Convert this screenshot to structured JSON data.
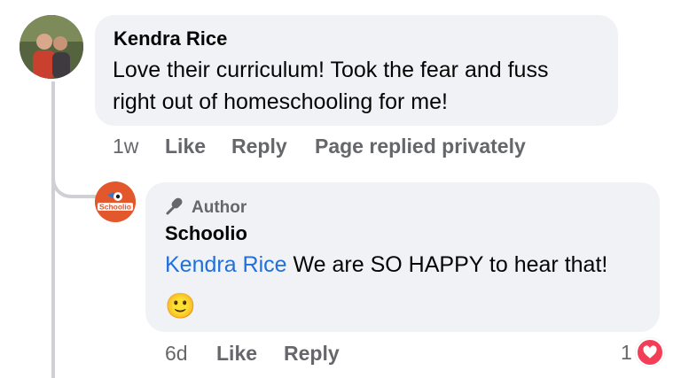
{
  "comment": {
    "author": "Kendra Rice",
    "text_line1": "Love their curriculum! Took the fear and fuss",
    "text_line2": "right out of homeschooling for me!",
    "time": "1w",
    "like_label": "Like",
    "reply_label": "Reply",
    "private_reply_label": "Page replied privately"
  },
  "reply": {
    "badge_label": "Author",
    "author": "Schoolio",
    "mention": "Kendra Rice",
    "text": " We are SO HAPPY to hear that!",
    "emoji": "🙂",
    "time": "6d",
    "like_label": "Like",
    "reply_label": "Reply",
    "reaction_count": "1",
    "reaction_icon": "heart-icon"
  },
  "colors": {
    "bubble": "#f0f2f5",
    "meta_text": "#65676b",
    "mention": "#216fdb",
    "heart": "#f33e58"
  }
}
